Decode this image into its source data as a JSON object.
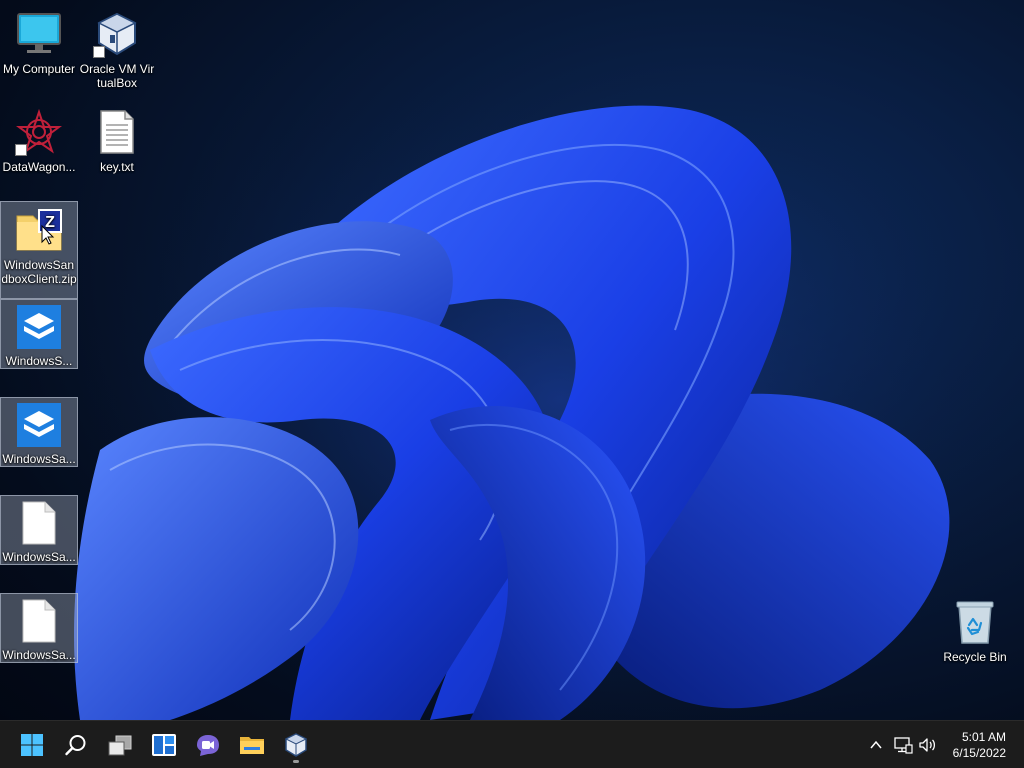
{
  "desktop": {
    "icons": [
      {
        "label": "My Computer",
        "icon": "monitor-icon"
      },
      {
        "label": "Oracle VM VirtualBox",
        "icon": "virtualbox-icon"
      },
      {
        "label": "DataWagon...",
        "icon": "datawagon-icon"
      },
      {
        "label": "key.txt",
        "icon": "text-file-icon"
      },
      {
        "label": "WindowsSandboxClient.zip",
        "icon": "zip-folder-icon"
      },
      {
        "label": "WindowsS...",
        "icon": "sandbox-icon"
      },
      {
        "label": "WindowsSa...",
        "icon": "sandbox-icon"
      },
      {
        "label": "WindowsSa...",
        "icon": "blank-file-icon"
      },
      {
        "label": "WindowsSa...",
        "icon": "blank-file-icon"
      },
      {
        "label": "Recycle Bin",
        "icon": "recycle-bin-icon"
      }
    ]
  },
  "taskbar": {
    "buttons": [
      {
        "name": "start",
        "icon": "windows-logo-icon"
      },
      {
        "name": "search",
        "icon": "search-icon"
      },
      {
        "name": "task-view",
        "icon": "task-view-icon"
      },
      {
        "name": "widgets",
        "icon": "widgets-icon"
      },
      {
        "name": "chat",
        "icon": "chat-icon"
      },
      {
        "name": "file-explorer",
        "icon": "folder-icon"
      },
      {
        "name": "virtualbox",
        "icon": "virtualbox-icon",
        "running": true
      }
    ],
    "tray": {
      "icons": [
        "chevron-up-icon",
        "network-icon",
        "volume-icon"
      ]
    },
    "clock": {
      "time": "5:01 AM",
      "date": "6/15/2022"
    }
  },
  "colors": {
    "taskbar_bg": "#1c1c1c",
    "wallpaper_accent": "#1f4fff",
    "selection": "#a0aab9"
  }
}
